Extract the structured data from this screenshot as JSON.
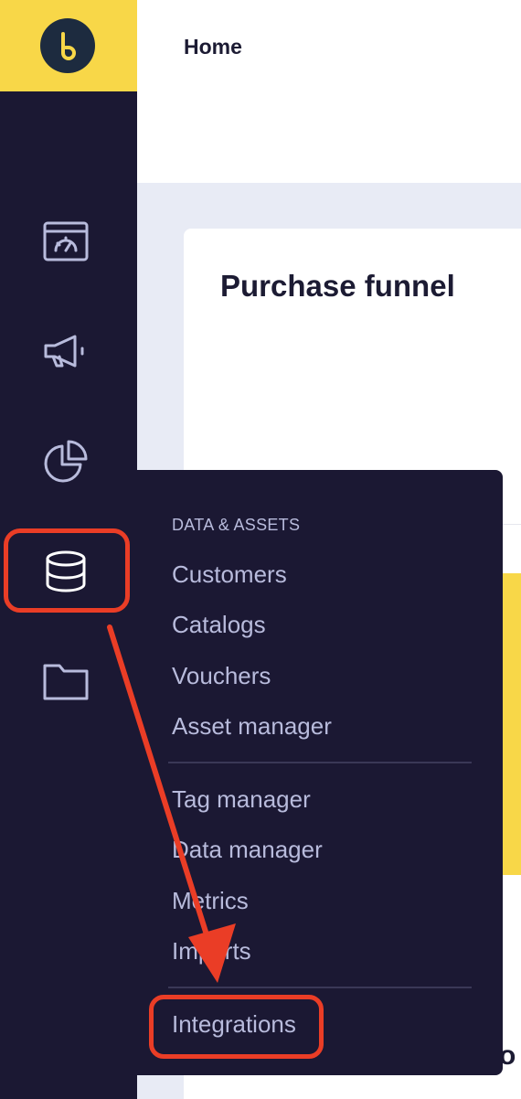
{
  "header": {
    "title": "Home"
  },
  "main": {
    "card_title": "Purchase funnel",
    "partial_text": "o"
  },
  "sidebar": {
    "icons": [
      "dashboard-icon",
      "megaphone-icon",
      "pie-chart-icon",
      "database-icon",
      "folder-icon"
    ],
    "active": "database-icon"
  },
  "dropdown": {
    "heading": "DATA & ASSETS",
    "group1": [
      "Customers",
      "Catalogs",
      "Vouchers",
      "Asset manager"
    ],
    "group2": [
      "Tag manager",
      "Data manager",
      "Metrics",
      "Imports"
    ],
    "group3": [
      "Integrations"
    ]
  },
  "colors": {
    "brand_yellow": "#f8d748",
    "sidebar_bg": "#1b1833",
    "menu_text": "#b8bbdc",
    "annotation_red": "#ea3d26"
  }
}
